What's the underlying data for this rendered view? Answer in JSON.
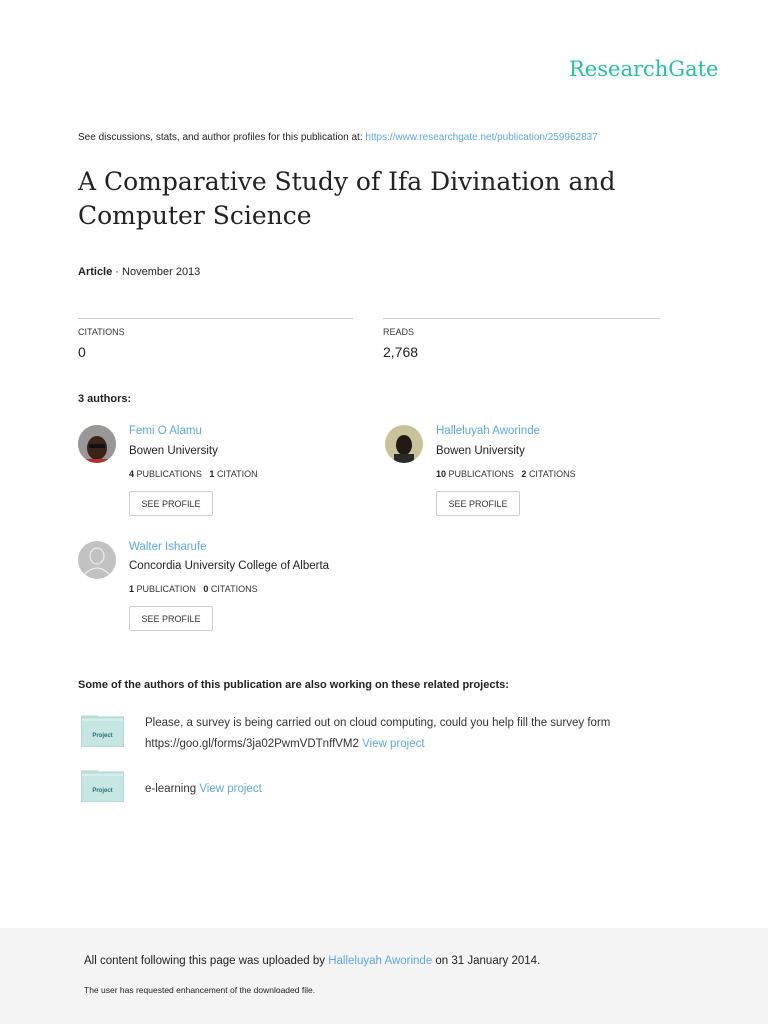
{
  "brand": "ResearchGate",
  "discussion": {
    "text": "See discussions, stats, and author profiles for this publication at: ",
    "url": "https://www.researchgate.net/publication/259962837"
  },
  "title": "A Comparative Study of Ifa Divination and Computer Science",
  "meta": {
    "type": "Article",
    "date": " · November 2013"
  },
  "citations": {
    "label": "CITATIONS",
    "value": "0"
  },
  "reads": {
    "label": "READS",
    "value": "2,768"
  },
  "authors_heading": "3 authors:",
  "authors": [
    {
      "name": "Femi O Alamu",
      "institution": "Bowen University",
      "pubs": "4",
      "pubs_label": "PUBLICATIONS",
      "cites": "1",
      "cites_label": "CITATION",
      "button": "SEE PROFILE"
    },
    {
      "name": "Halleluyah Aworinde",
      "institution": "Bowen University",
      "pubs": "10",
      "pubs_label": "PUBLICATIONS",
      "cites": "2",
      "cites_label": "CITATIONS",
      "button": "SEE PROFILE"
    },
    {
      "name": "Walter Isharufe",
      "institution": "Concordia University College of Alberta",
      "pubs": "1",
      "pubs_label": "PUBLICATION",
      "cites": "0",
      "cites_label": "CITATIONS",
      "button": "SEE PROFILE"
    }
  ],
  "projects_heading": "Some of the authors of this publication are also working on these related projects:",
  "projects": [
    {
      "icon_label": "Project",
      "line1": "Please, a survey is being carried out on cloud computing, could you help fill the survey form",
      "line2": "https://goo.gl/forms/3ja02PwmVDTnffVM2 ",
      "link": "View project"
    },
    {
      "icon_label": "Project",
      "line1": "e-learning ",
      "link": "View project"
    }
  ],
  "footer": {
    "prefix": "All content following this page was uploaded by ",
    "uploader": "Halleluyah Aworinde",
    "suffix": " on 31 January 2014.",
    "note": "The user has requested enhancement of the downloaded file."
  }
}
